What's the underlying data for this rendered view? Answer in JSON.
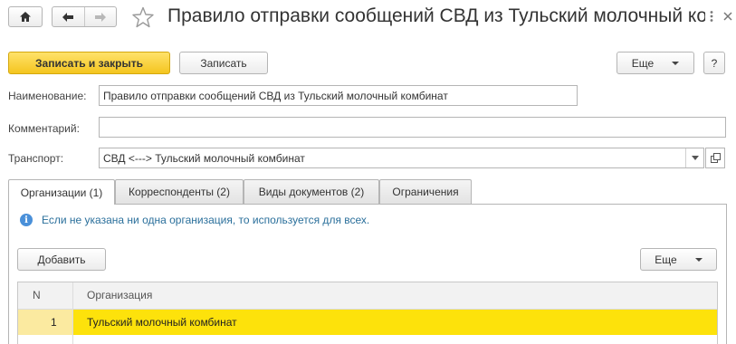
{
  "window": {
    "title": "Правило отправки сообщений СВД из Тульский молочный ко..."
  },
  "toolbar": {
    "save_close_label": "Записать и закрыть",
    "save_label": "Записать",
    "more_label": "Еще",
    "help_label": "?"
  },
  "form": {
    "name_label": "Наименование:",
    "name_value": "Правило отправки сообщений СВД из Тульский молочный комбинат",
    "comment_label": "Комментарий:",
    "comment_value": "",
    "transport_label": "Транспорт:",
    "transport_value": "СВД <---> Тульский молочный комбинат"
  },
  "tabs": [
    {
      "label": "Организации (1)",
      "active": true
    },
    {
      "label": "Корреспонденты (2)",
      "active": false
    },
    {
      "label": "Виды документов (2)",
      "active": false
    },
    {
      "label": "Ограничения",
      "active": false
    }
  ],
  "panel": {
    "info_text": "Если не указана ни одна организация, то используется для всех.",
    "add_label": "Добавить",
    "more_label": "Еще"
  },
  "table": {
    "columns": [
      "N",
      "Организация"
    ],
    "rows": [
      {
        "n": "1",
        "organization": "Тульский молочный комбинат",
        "selected": true
      }
    ]
  },
  "colors": {
    "primary_button": "#f4c51f",
    "selected_row": "#fde20b",
    "info_text": "#2a6f9b"
  },
  "icons": {
    "home": "home-icon",
    "back": "arrow-left-icon",
    "forward": "arrow-right-icon",
    "favorite": "star-outline-icon",
    "more_window": "vertical-dots-icon",
    "close": "close-icon",
    "info": "info-icon",
    "dropdown": "chevron-down-icon",
    "open": "open-form-icon"
  }
}
